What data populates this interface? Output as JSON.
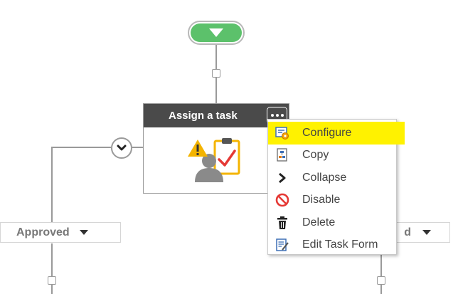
{
  "workflow": {
    "task": {
      "title": "Assign a task"
    },
    "branches": {
      "left_label": "Approved",
      "right_label_visible_fragment": "d"
    }
  },
  "context_menu": {
    "items": [
      {
        "label": "Configure",
        "icon": "configure-icon",
        "highlighted": true
      },
      {
        "label": "Copy",
        "icon": "copy-icon",
        "highlighted": false
      },
      {
        "label": "Collapse",
        "icon": "chevron-right-icon",
        "highlighted": false
      },
      {
        "label": "Disable",
        "icon": "disable-icon",
        "highlighted": false
      },
      {
        "label": "Delete",
        "icon": "trash-icon",
        "highlighted": false
      },
      {
        "label": "Edit Task Form",
        "icon": "edit-form-icon",
        "highlighted": false
      }
    ]
  },
  "colors": {
    "start_node": "#5cc16b",
    "task_header": "#4a4a4a",
    "highlight": "#fff200",
    "connector": "#9a9a9a",
    "disable_icon": "#e53935",
    "warning_icon": "#f4b400",
    "check_icon": "#e53935"
  }
}
